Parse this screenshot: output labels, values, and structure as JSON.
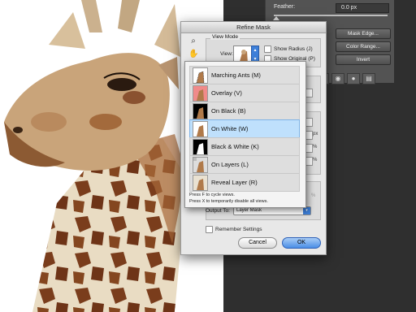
{
  "colors": {
    "panel_bg": "#535353",
    "dialog_bg": "#e8e8e8",
    "selection": "#bfe0fc",
    "accent_blue": "#3d7fd9",
    "workspace_bg": "#2f2f2f"
  },
  "properties_panel": {
    "feather_label": "Feather:",
    "feather_value": "0.0 px",
    "buttons": {
      "mask_edge": "Mask Edge...",
      "color_range": "Color Range...",
      "invert": "Invert"
    },
    "icons": [
      "selection-icon",
      "eye-icon",
      "visibility-icon",
      "trash-icon"
    ]
  },
  "dialog": {
    "title": "Refine Mask",
    "tools": [
      "zoom-icon",
      "hand-icon"
    ],
    "view_mode": {
      "group_title": "View Mode",
      "view_label": "View:",
      "show_radius": "Show Radius (J)",
      "show_original": "Show Original (P)"
    },
    "output": {
      "output_to_label": "Output To:",
      "output_to_value": "Layer Mask"
    },
    "remember_settings": "Remember Settings",
    "cancel": "Cancel",
    "ok": "OK"
  },
  "view_menu": {
    "selected_index": 3,
    "items": [
      {
        "label": "Marching Ants (M)",
        "icon": "marching-ants-icon"
      },
      {
        "label": "Overlay (V)",
        "icon": "overlay-icon"
      },
      {
        "label": "On Black (B)",
        "icon": "on-black-icon"
      },
      {
        "label": "On White (W)",
        "icon": "on-white-icon"
      },
      {
        "label": "Black & White (K)",
        "icon": "black-white-icon"
      },
      {
        "label": "On Layers (L)",
        "icon": "on-layers-icon"
      },
      {
        "label": "Reveal Layer (R)",
        "icon": "reveal-layer-icon"
      }
    ],
    "hint1": "Press F to cycle views.",
    "hint2": "Press X to temporarily disable all views."
  }
}
